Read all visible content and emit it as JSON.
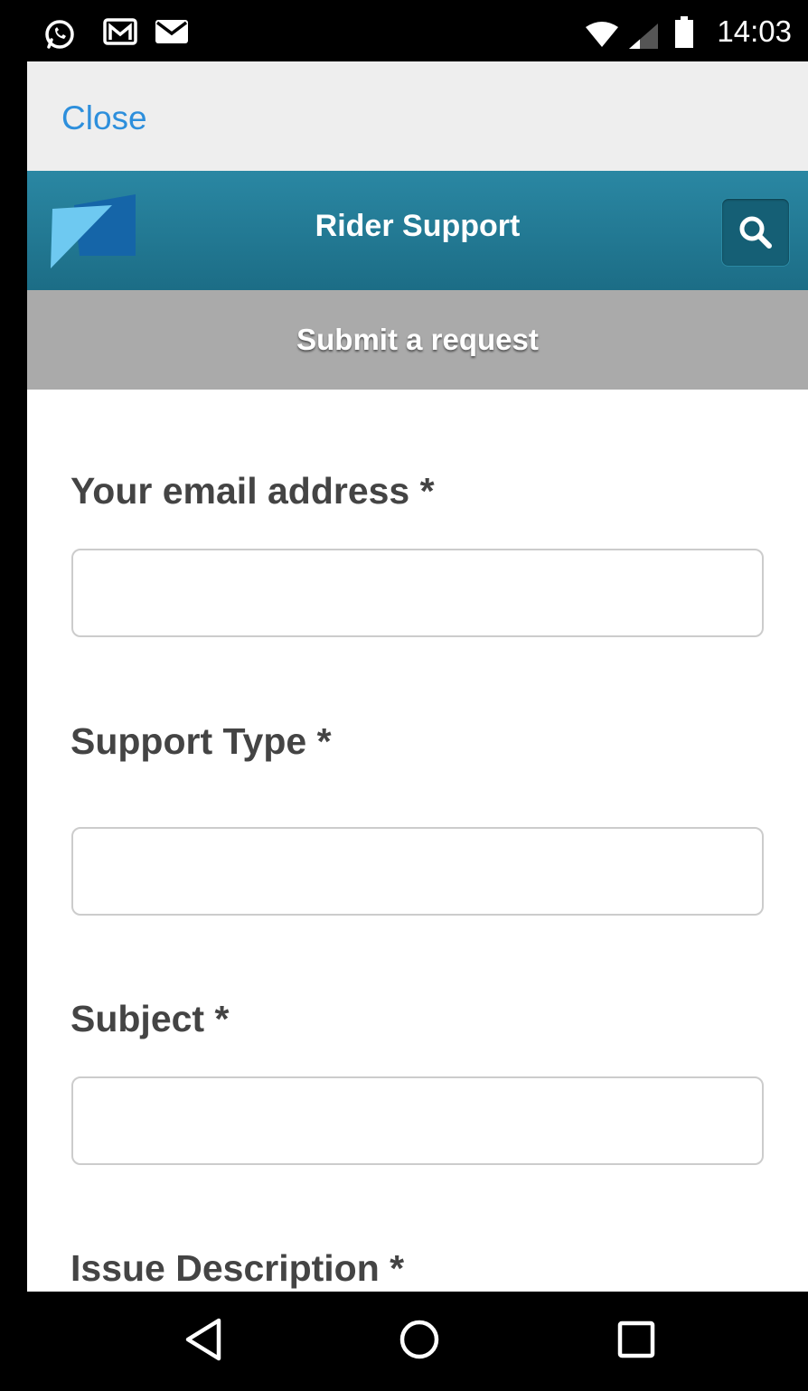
{
  "status_bar": {
    "time": "14:03",
    "left_icons": [
      "whatsapp-icon",
      "gmail-icon",
      "mail-icon"
    ],
    "right_icons": [
      "wifi-icon",
      "signal-icon",
      "battery-icon"
    ]
  },
  "top_bar": {
    "close_label": "Close"
  },
  "header": {
    "title": "Rider Support",
    "search_icon": "search-icon",
    "logo_icon": "logo-icon"
  },
  "subheader": {
    "title": "Submit a request"
  },
  "form": {
    "fields": [
      {
        "label": "Your email address *",
        "value": ""
      },
      {
        "label": "Support Type *",
        "value": ""
      },
      {
        "label": "Subject *",
        "value": ""
      },
      {
        "label": "Issue Description *"
      }
    ]
  },
  "nav_bar": {
    "buttons": [
      "back-icon",
      "home-icon",
      "recents-icon"
    ]
  },
  "colors": {
    "link_blue": "#2d8fdc",
    "header_teal": "#1f7892",
    "subheader_gray": "#aaaaaa",
    "label_gray": "#444444",
    "close_bar_bg": "#eeeeee"
  }
}
